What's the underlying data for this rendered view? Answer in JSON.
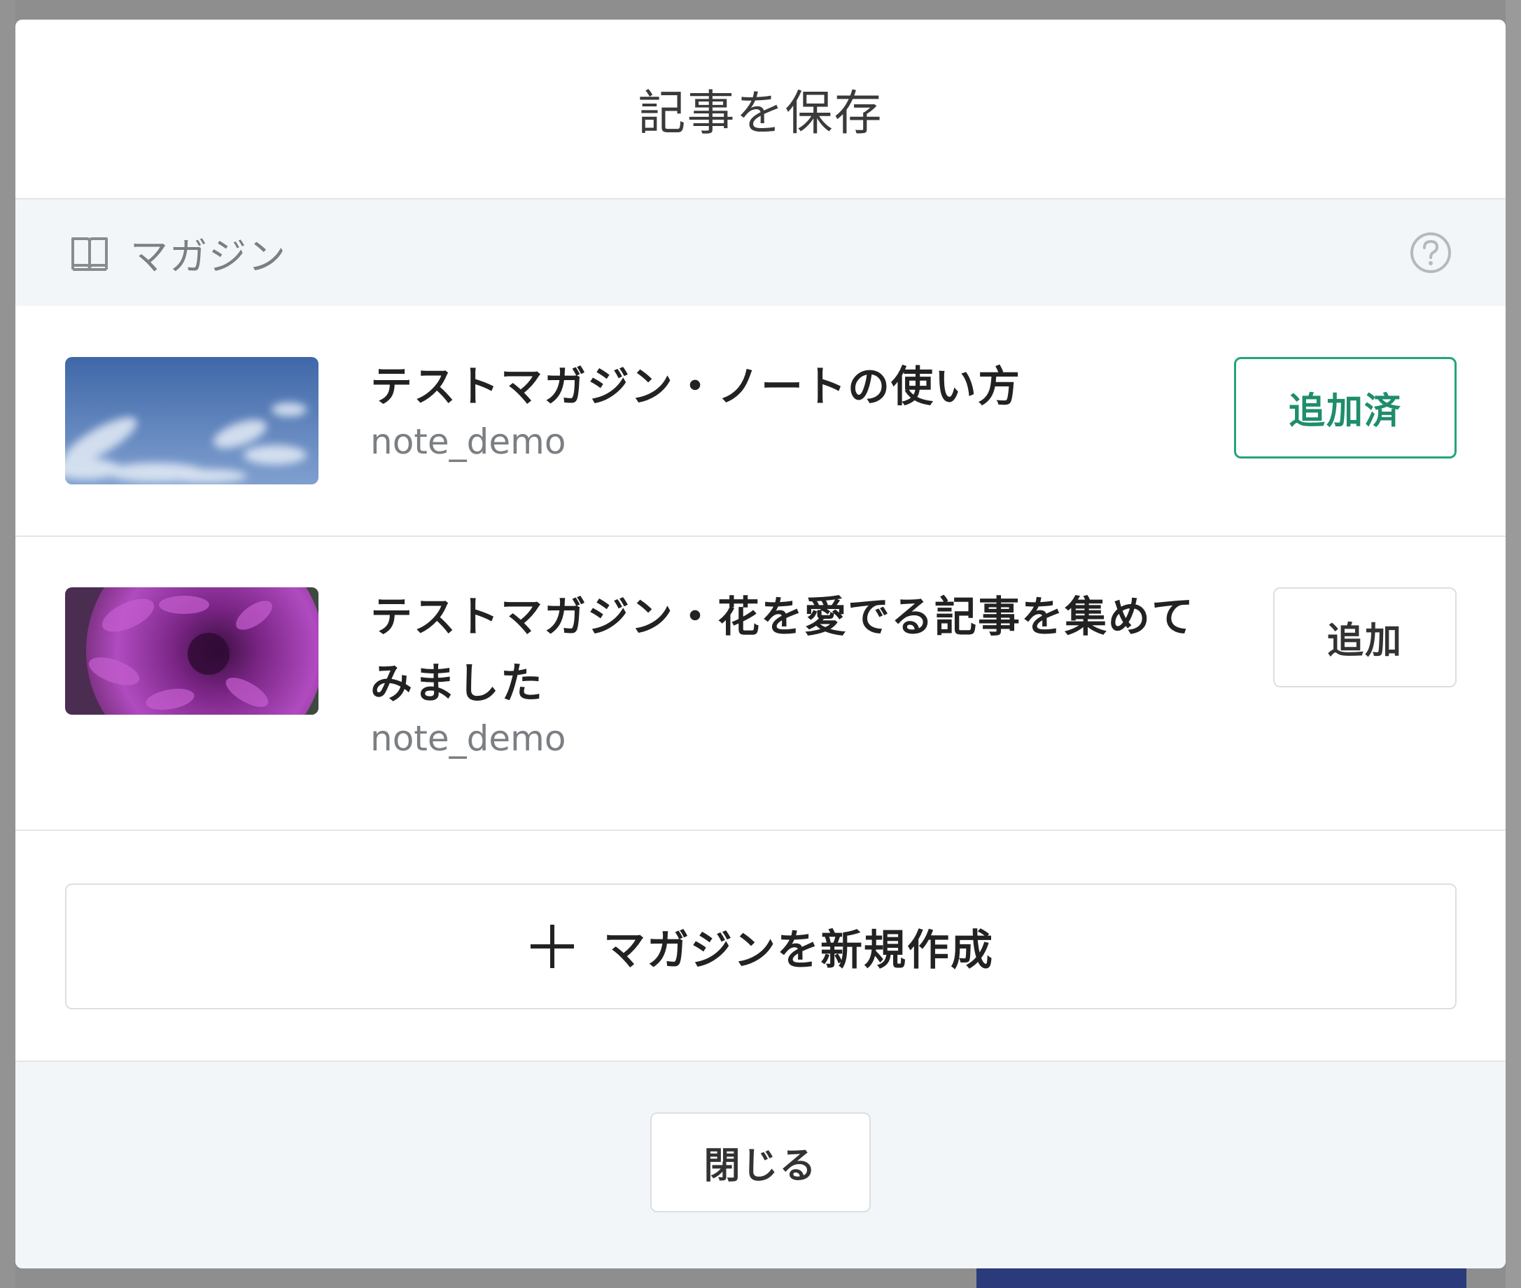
{
  "modal": {
    "title": "記事を保存"
  },
  "section": {
    "label": "マガジン",
    "icon": "book-icon",
    "help_icon": "help-circle-icon"
  },
  "magazines": [
    {
      "title": "テストマガジン・ノートの使い方",
      "owner": "note_demo",
      "button_label": "追加済",
      "state": "added",
      "thumbnail": "sky-with-clouds"
    },
    {
      "title": "テストマガジン・花を愛でる記事を集めてみました",
      "owner": "note_demo",
      "button_label": "追加",
      "state": "not-added",
      "thumbnail": "purple-dahlia-flower"
    }
  ],
  "create": {
    "label": "マガジンを新規作成",
    "icon": "plus-icon"
  },
  "footer": {
    "close_label": "閉じる"
  },
  "colors": {
    "accent": "#24a47a",
    "section_bg": "#f3f6f8",
    "overlay": "#8c8c8c"
  }
}
